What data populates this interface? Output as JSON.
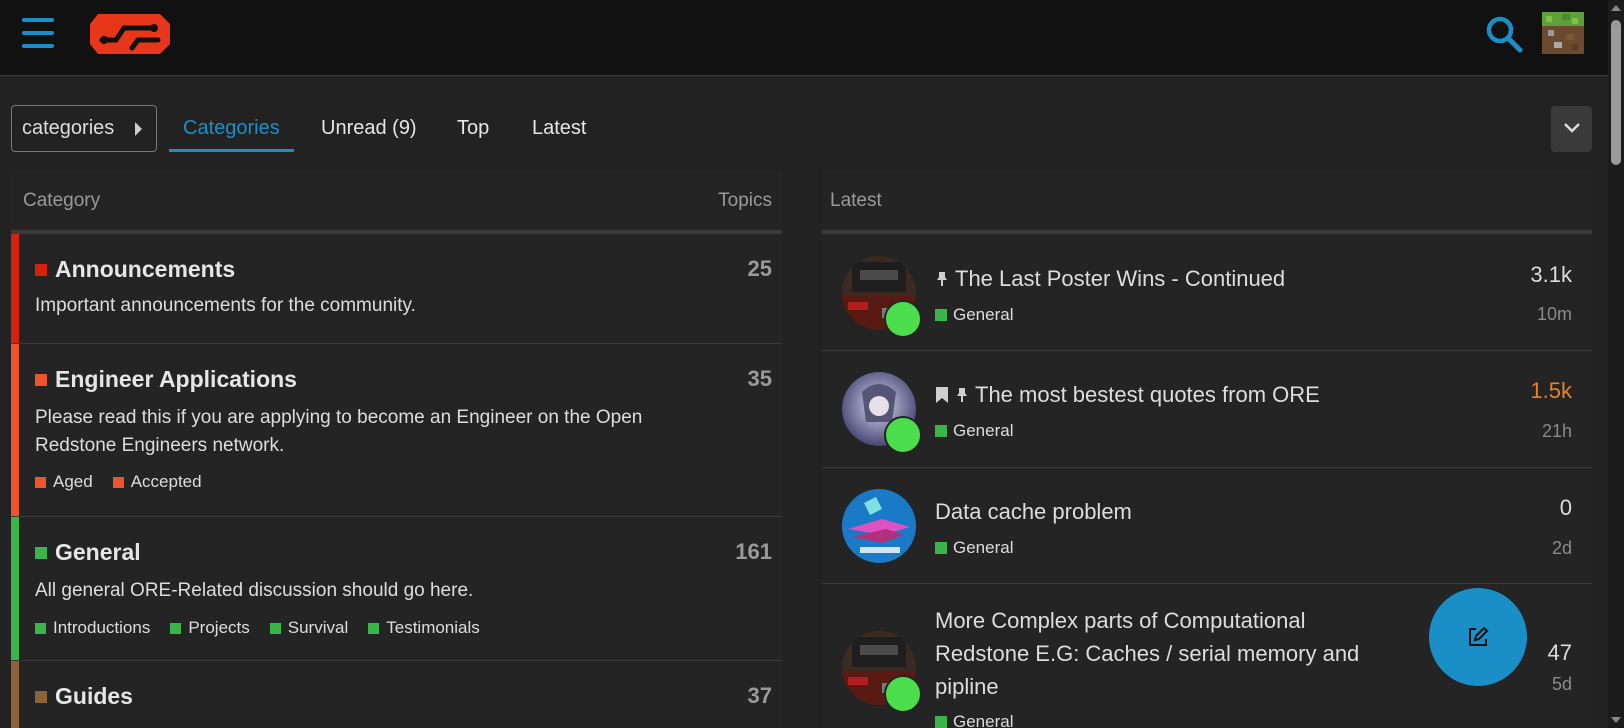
{
  "header": {
    "menu_icon": "hamburger-icon",
    "logo_icon": "ore-logo-icon",
    "search_icon": "search-icon",
    "user_avatar_icon": "minecraft-grass-block-avatar"
  },
  "nav": {
    "dropdown_label": "categories",
    "tabs": [
      {
        "label": "Categories",
        "active": true
      },
      {
        "label": "Unread (9)",
        "active": false
      },
      {
        "label": "Top",
        "active": false
      },
      {
        "label": "Latest",
        "active": false
      }
    ],
    "more_icon": "chevron-down-icon"
  },
  "categories_table": {
    "col_category": "Category",
    "col_topics": "Topics",
    "rows": [
      {
        "name": "Announcements",
        "color": "#d3230f",
        "topics": "25",
        "description": "Important announcements for the community.",
        "subcategories": []
      },
      {
        "name": "Engineer Applications",
        "color": "#f0542a",
        "topics": "35",
        "description": "Please read this if you are applying to become an Engineer on the Open Redstone Engineers network.",
        "subcategories": [
          {
            "name": "Aged",
            "color": "#f0542a"
          },
          {
            "name": "Accepted",
            "color": "#f0542a"
          }
        ]
      },
      {
        "name": "General",
        "color": "#3ab54a",
        "topics": "161",
        "description": "All general ORE-Related discussion should go here.",
        "subcategories": [
          {
            "name": "Introductions",
            "color": "#3ab54a"
          },
          {
            "name": "Projects",
            "color": "#3ab54a"
          },
          {
            "name": "Survival",
            "color": "#3ab54a"
          },
          {
            "name": "Testimonials",
            "color": "#3ab54a"
          }
        ]
      },
      {
        "name": "Guides",
        "color": "#8c6238",
        "topics": "37",
        "description": "",
        "subcategories": []
      }
    ]
  },
  "latest_table": {
    "header": "Latest",
    "topics": [
      {
        "title": "The Last Poster Wins - Continued",
        "icons": [
          "pinned-icon"
        ],
        "category": "General",
        "category_color": "#3ab54a",
        "posts": "3.1k",
        "posts_color": "#dddddd",
        "age": "10m",
        "avatar": "dark-skin-avatar",
        "online": true
      },
      {
        "title": "The most bestest quotes from ORE",
        "icons": [
          "bookmark-icon",
          "pinned-icon"
        ],
        "category": "General",
        "category_color": "#3ab54a",
        "posts": "1.5k",
        "posts_color": "#e8802d",
        "age": "21h",
        "avatar": "anime-character-avatar",
        "online": true
      },
      {
        "title": "Data cache problem",
        "icons": [],
        "category": "General",
        "category_color": "#3ab54a",
        "posts": "0",
        "posts_color": "#dddddd",
        "age": "2d",
        "avatar": "michigu-logo-avatar",
        "online": false
      },
      {
        "title": "More Complex parts of Computational Redstone E.G: Caches / serial memory and pipline",
        "icons": [],
        "category": "General",
        "category_color": "#3ab54a",
        "posts": "47",
        "posts_color": "#dddddd",
        "age": "5d",
        "avatar": "dark-skin-avatar",
        "online": true
      }
    ]
  },
  "fab": {
    "icon": "new-topic-pencil-icon"
  },
  "colors": {
    "accent": "#1a8fc7",
    "background": "#222222",
    "header_bg": "#111111",
    "online": "#4cdd4c"
  }
}
